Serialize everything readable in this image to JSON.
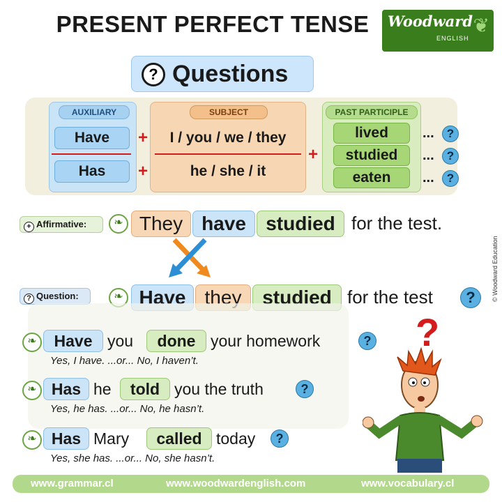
{
  "title": "PRESENT PERFECT TENSE",
  "logo": {
    "name": "Woodward",
    "sub": "ENGLISH"
  },
  "questions_heading": {
    "icon": "?",
    "label": "Questions"
  },
  "table": {
    "auxiliary": {
      "header": "AUXILIARY",
      "items": [
        "Have",
        "Has"
      ]
    },
    "subject": {
      "header": "SUBJECT",
      "items": [
        "I / you / we / they",
        "he / she / it"
      ]
    },
    "past_participle": {
      "header": "PAST PARTICIPLE",
      "items": [
        "lived",
        "studied",
        "eaten"
      ]
    },
    "plus": "+",
    "dots": "...",
    "qmark": "?"
  },
  "affirmative": {
    "label": "Affirmative:",
    "icon": "+",
    "words": [
      "They",
      "have",
      "studied",
      "for the test."
    ]
  },
  "question": {
    "label": "Question:",
    "icon": "?",
    "words": [
      "Have",
      "they",
      "studied",
      "for the test"
    ]
  },
  "examples": [
    {
      "aux": "Have",
      "subject": "you",
      "participle": "done",
      "rest": "your homework",
      "answer": "Yes, I have.  ...or...  No, I haven’t."
    },
    {
      "aux": "Has",
      "subject": "he",
      "participle": "told",
      "rest": "you the truth",
      "answer": "Yes, he has.  ...or...  No, he hasn’t."
    },
    {
      "aux": "Has",
      "subject": "Mary",
      "participle": "called",
      "rest": "today",
      "answer": "Yes, she has.  ...or...  No, she hasn’t."
    }
  ],
  "copyright": "© Woodward Education",
  "footer": {
    "links": [
      "www.grammar.cl",
      "www.woodwardenglish.com",
      "www.vocabulary.cl"
    ]
  },
  "colors": {
    "auxiliary": "#cbe4f8",
    "subject": "#f8d7b6",
    "participle": "#d7ecc1",
    "plus": "#d41c1c",
    "footer": "#b2d98b"
  }
}
